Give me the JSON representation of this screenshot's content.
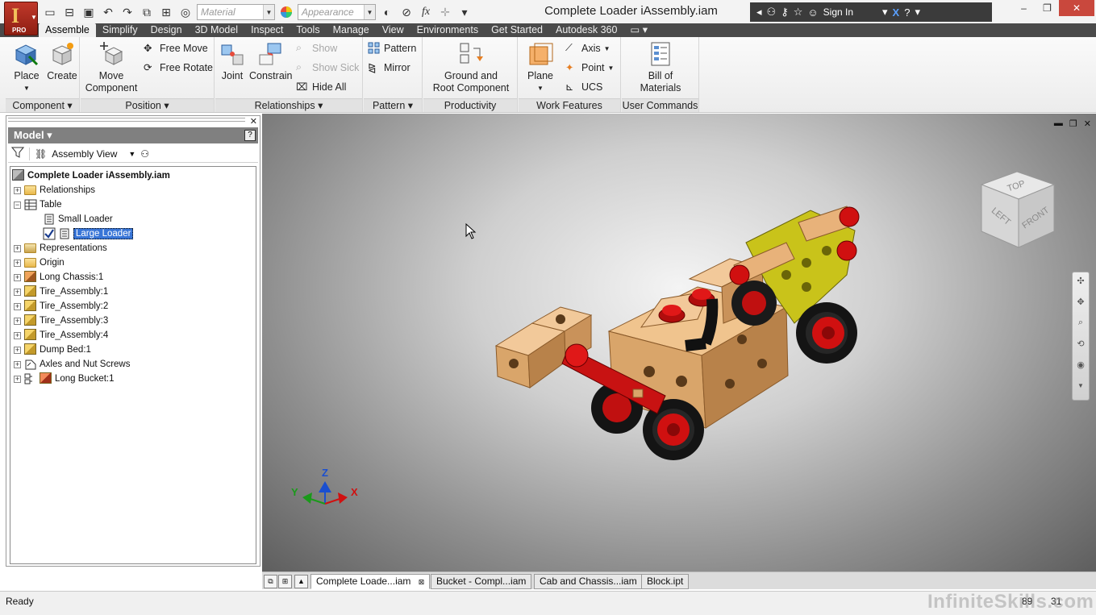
{
  "app": {
    "logo_letter": "I",
    "logo_badge": "PRO",
    "window_title": "Complete Loader iAssembly.iam"
  },
  "quick_access": {
    "material_placeholder": "Material",
    "appearance_placeholder": "Appearance",
    "function_symbol": "fx"
  },
  "helpbar": {
    "sign_in": "Sign In"
  },
  "ribbon_tabs": [
    "Assemble",
    "Simplify",
    "Design",
    "3D Model",
    "Inspect",
    "Tools",
    "Manage",
    "View",
    "Environments",
    "Get Started",
    "Autodesk 360"
  ],
  "ribbon": {
    "component": {
      "title": "Component",
      "place": "Place",
      "create": "Create"
    },
    "position": {
      "title": "Position",
      "move_component": "Move Component",
      "move_line1": "Move",
      "move_line2": "Component",
      "free_move": "Free Move",
      "free_rotate": "Free Rotate"
    },
    "relationships": {
      "title": "Relationships",
      "joint": "Joint",
      "constrain": "Constrain",
      "show": "Show",
      "show_sick": "Show Sick",
      "hide_all": "Hide All"
    },
    "pattern": {
      "title": "Pattern",
      "pattern": "Pattern",
      "mirror": "Mirror"
    },
    "productivity": {
      "title": "Productivity",
      "ground_line1": "Ground and",
      "ground_line2": "Root Component"
    },
    "work_features": {
      "title": "Work Features",
      "plane": "Plane",
      "axis": "Axis",
      "point": "Point",
      "ucs": "UCS"
    },
    "user_commands": {
      "title": "User Commands",
      "bom_line1": "Bill of",
      "bom_line2": "Materials"
    }
  },
  "browser": {
    "title": "Model",
    "view_mode": "Assembly View",
    "root": "Complete Loader iAssembly.iam",
    "nodes": [
      "Relationships",
      "Table",
      "Small Loader",
      "Large Loader",
      "Representations",
      "Origin",
      "Long Chassis:1",
      "Tire_Assembly:1",
      "Tire_Assembly:2",
      "Tire_Assembly:3",
      "Tire_Assembly:4",
      "Dump Bed:1",
      "Axles and Nut Screws",
      "Long Bucket:1"
    ]
  },
  "viewcube": {
    "top": "TOP",
    "left": "LEFT",
    "front": "FRONT"
  },
  "triad": {
    "x": "X",
    "y": "Y",
    "z": "Z"
  },
  "doc_tabs": [
    "Complete Loade...iam",
    "Bucket - Compl...iam",
    "Cab and Chassis...iam",
    "Block.ipt"
  ],
  "status": {
    "text": "Ready",
    "value1": "89",
    "value2": "31"
  },
  "watermark": "InfiniteSkills.com",
  "colors": {
    "ribbon_tab_bg": "#4a4a4a",
    "app_button": "#c0392b",
    "selection": "#3875d7",
    "part_red": "#d01010",
    "part_wood": "#d9a56a",
    "part_yellow": "#c9c31a"
  }
}
